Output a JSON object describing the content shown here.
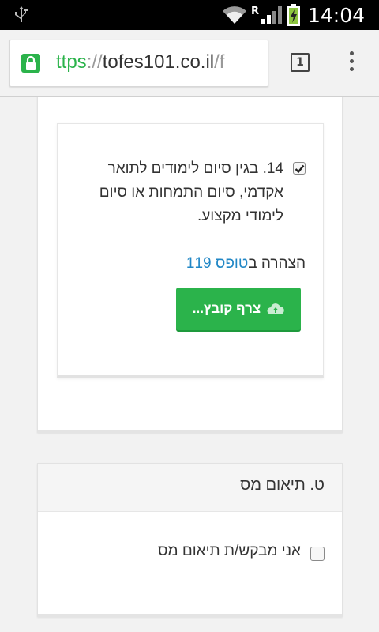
{
  "status_bar": {
    "time": "14:04",
    "roaming_indicator": "R",
    "icons": [
      "usb-icon",
      "wifi-icon",
      "signal-icon",
      "battery-charging-icon"
    ]
  },
  "browser": {
    "url_scheme": "ttps",
    "url_sep": "://",
    "url_host": "tofes101.co.il",
    "url_path": "/f",
    "tab_count": "1",
    "icons": [
      "lock-icon",
      "tabs-icon",
      "menu-icon"
    ]
  },
  "section_s": {
    "item14": {
      "checked": true,
      "text": "14. בגין סיום לימודים לתואר אקדמי, סיום התמחות או סיום לימודי מקצוע."
    },
    "declaration_prefix": "הצהרה ב",
    "declaration_link": "טופס 119",
    "attach_button": "צרף קובץ...",
    "accent_color": "#2bb34b",
    "link_color": "#2187c6"
  },
  "section_t": {
    "title": "ט. תיאום מס",
    "checkbox_label": "אני מבקש/ת תיאום מס",
    "checked": false
  }
}
